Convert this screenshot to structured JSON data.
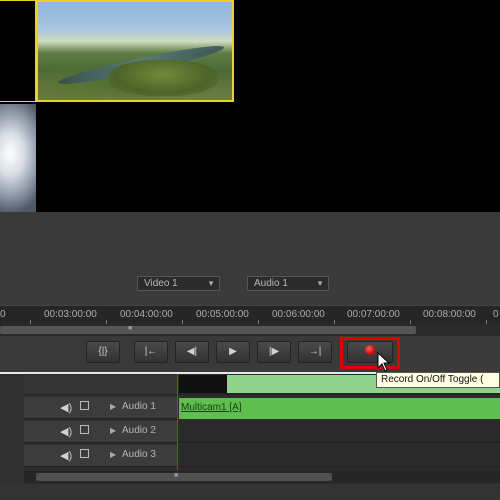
{
  "monitor": {
    "selected_border_color": "#e6d422"
  },
  "source_menus": [
    {
      "label": "Video 1"
    },
    {
      "label": "Audio 1"
    }
  ],
  "ruler": {
    "start_fragment": "0",
    "timecodes": [
      "00:03:00:00",
      "00:04:00:00",
      "00:05:00:00",
      "00:06:00:00",
      "00:07:00:00",
      "00:08:00:00",
      "0"
    ]
  },
  "transport": {
    "buttons": [
      {
        "symbol": "{|}"
      },
      {
        "symbol": "|←"
      },
      {
        "symbol": "◀|"
      },
      {
        "symbol": "▶"
      },
      {
        "symbol": "|▶"
      },
      {
        "symbol": "→|"
      }
    ],
    "record_tooltip": "Record On/Off Toggle (",
    "highlight_color": "#e00000"
  },
  "tracks": [
    {
      "name": "Audio 1"
    },
    {
      "name": "Audio 2"
    },
    {
      "name": "Audio 3"
    }
  ],
  "clips": {
    "audio1_label": "Multicam1 [A]",
    "audio_color": "#5fbf4e",
    "video_color": "#8fd48a"
  }
}
